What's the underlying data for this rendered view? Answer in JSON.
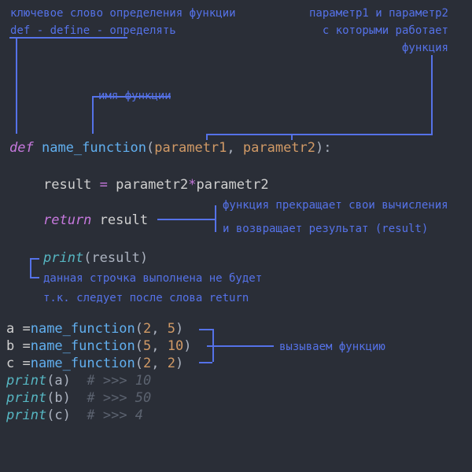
{
  "annotations": {
    "def_keyword_1": "ключевое слово определения функции",
    "def_keyword_2": "def - define - определять",
    "fn_name_label": "имя функции",
    "params_1": "параметр1 и параметр2",
    "params_2": "с которыми работает",
    "params_3": "функция",
    "return_1": "функция прекращает свои вычисления",
    "return_2": "и возвращает результат (result)",
    "unreachable_1": "данная строчка выполнена не будет",
    "unreachable_2": "т.к. следует после слова return",
    "call_label": "вызываем функцию"
  },
  "code": {
    "def": "def",
    "fn_name": "name_function",
    "param1": "parametr1",
    "param2": "parametr2",
    "body_line": "result = parametr2*parametr2",
    "return_kw": "return",
    "return_val": "result",
    "print_kw": "print",
    "print_arg": "(result)",
    "a_assign_pre": "a =",
    "b_assign_pre": "b =",
    "c_assign_pre": "c =",
    "call_fn": "name_function",
    "call_a_args": "(2, 5)",
    "call_b_args": "(5, 10)",
    "call_c_args": "(2, 2)",
    "print_a": "(a)",
    "print_b": "(b)",
    "print_c": "(c)",
    "comment_a": "  # >>> 10",
    "comment_b": "  # >>> 50",
    "comment_c": "  # >>> 4"
  }
}
